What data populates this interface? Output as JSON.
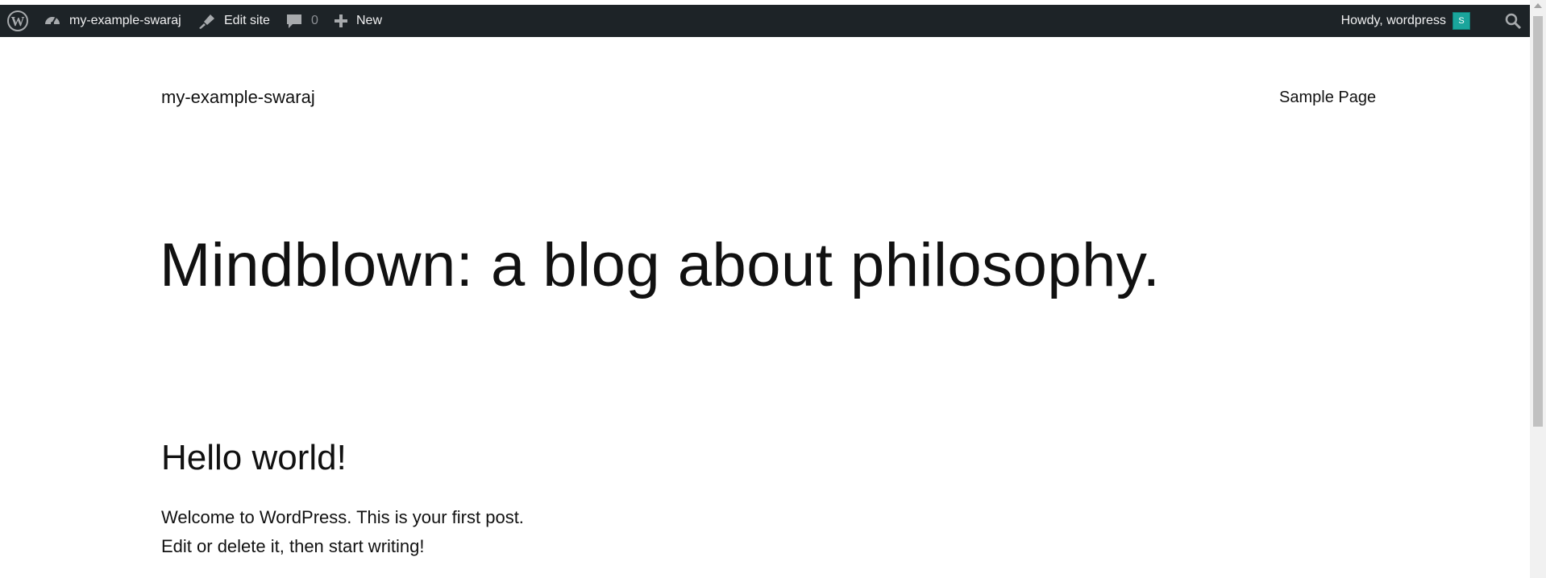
{
  "admin_bar": {
    "site_name": "my-example-swaraj",
    "edit_site": "Edit site",
    "comments_count": "0",
    "new_label": "New",
    "howdy": "Howdy, wordpress",
    "avatar_initial": "S"
  },
  "site": {
    "title": "my-example-swaraj",
    "nav_item": "Sample Page",
    "tagline": "Mindblown: a blog about philosophy."
  },
  "post": {
    "title": "Hello world!",
    "line1": "Welcome to WordPress. This is your first post.",
    "line2": "Edit or delete it, then start writing!"
  },
  "colors": {
    "admin_bar_bg": "#1d2327",
    "avatar_bg": "#1aa59c"
  }
}
